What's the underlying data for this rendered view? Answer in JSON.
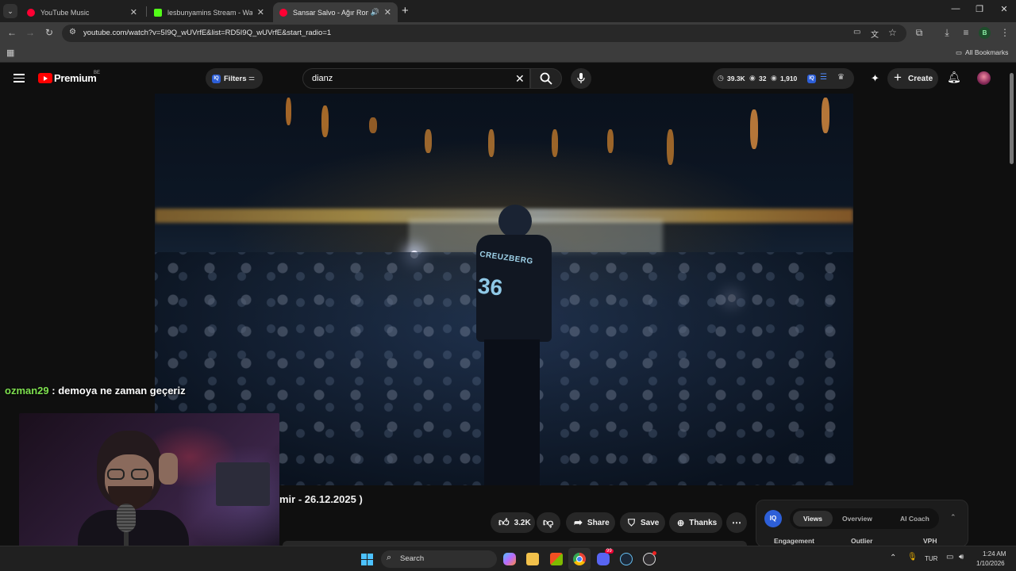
{
  "browser": {
    "tabs": [
      {
        "title": "YouTube Music",
        "favicon_color": "#ff0033",
        "active": false
      },
      {
        "title": "lesbunyamins Stream - Watch L",
        "favicon_color": "#53fc18",
        "active": false
      },
      {
        "title": "Sansar Salvo - Ağır Roman (",
        "favicon_color": "#ff0033",
        "active": true
      }
    ],
    "url": "youtube.com/watch?v=5I9Q_wUVrfE&list=RD5I9Q_wUVrfE&start_radio=1",
    "bookmarks_label": "All Bookmarks",
    "profile_initial": "B"
  },
  "youtube": {
    "logo_text": "Premium",
    "country_code": "BE",
    "filters_label": "Filters",
    "search_value": "dianz",
    "stats": {
      "a": "39.3K",
      "b": "32",
      "c": "1,910"
    },
    "create_label": "Create"
  },
  "video": {
    "jersey_text": "CREUZBERG",
    "jersey_number": "36",
    "title_partial": "mir - 26.12.2025 )"
  },
  "actions": {
    "likes": "3.2K",
    "share": "Share",
    "save": "Save",
    "thanks": "Thanks"
  },
  "chat": {
    "user": "ozman29",
    "separator": " : ",
    "message": "demoya ne zaman geçeriz",
    "user_color": "#7ee04f"
  },
  "iq_panel": {
    "tabs": [
      "Views",
      "Overview",
      "AI Coach"
    ],
    "active_tab": "Views",
    "columns": [
      "Engagement",
      "Outlier",
      "VPH"
    ]
  },
  "taskbar": {
    "search_placeholder": "Search",
    "language": "TUR",
    "time": "1:24 AM",
    "date": "1/10/2026",
    "discord_badge": "99"
  }
}
